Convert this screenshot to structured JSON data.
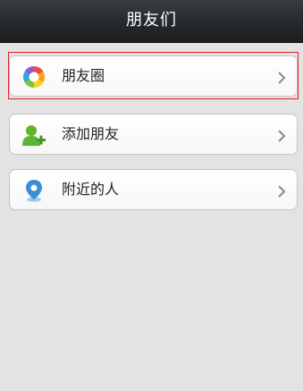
{
  "header": {
    "title": "朋友们"
  },
  "menu": {
    "items": [
      {
        "label": "朋友圈",
        "icon": "moments-aperture-icon"
      },
      {
        "label": "添加朋友",
        "icon": "add-friend-icon"
      },
      {
        "label": "附近的人",
        "icon": "location-pin-icon"
      }
    ]
  },
  "colors": {
    "header_bg": "#26292c",
    "page_bg": "#e3e3e3",
    "focus_outline": "#e02020",
    "add_friend_green": "#5cb531",
    "pin_blue": "#3d8ed6"
  }
}
